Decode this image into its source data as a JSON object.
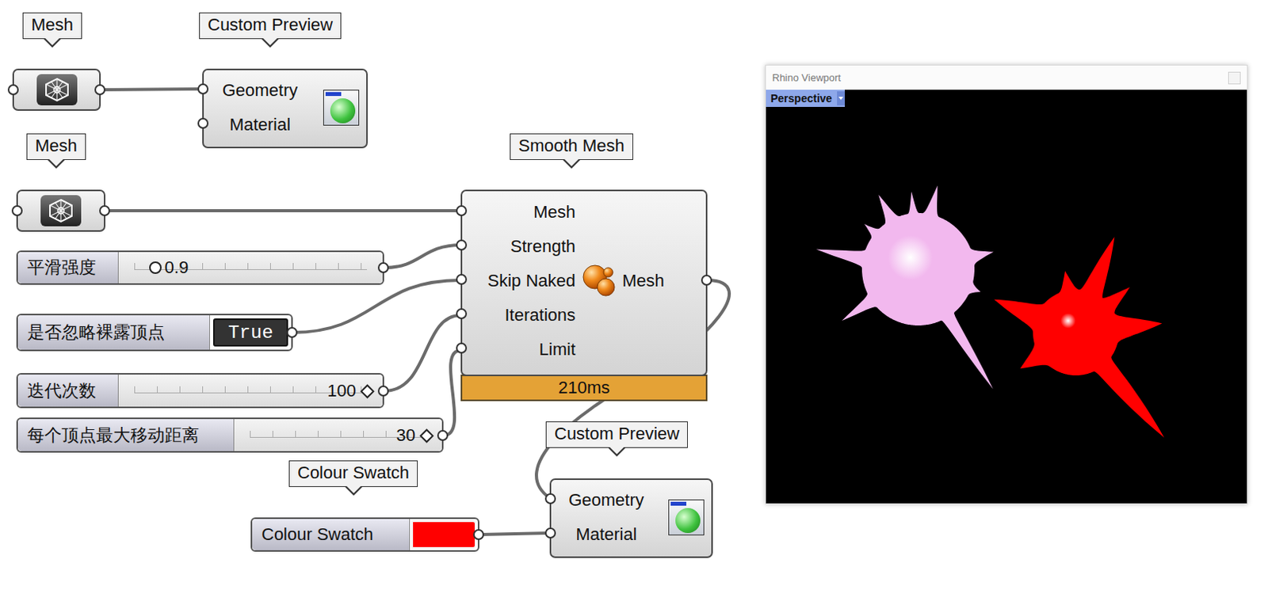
{
  "canvas": {
    "nodes": [
      {
        "kind": "mesh",
        "tag": "Mesh"
      },
      {
        "kind": "preview",
        "tag": "Custom Preview",
        "inputs": [
          "Geometry",
          "Material"
        ]
      },
      {
        "kind": "mesh",
        "tag": "Mesh"
      },
      {
        "kind": "component",
        "tag": "Smooth Mesh",
        "inputs": [
          "Mesh",
          "Strength",
          "Skip Naked",
          "Iterations",
          "Limit"
        ],
        "output": "Mesh",
        "time": "210ms"
      },
      {
        "kind": "slider",
        "label": "平滑强度",
        "value": "0.9",
        "level": 0.09,
        "handle": "circle"
      },
      {
        "kind": "toggle",
        "label": "是否忽略裸露顶点",
        "value": "True",
        "on": true
      },
      {
        "kind": "slider",
        "label": "迭代次数",
        "value": "100",
        "level": 1,
        "handle": "diamond"
      },
      {
        "kind": "slider",
        "label": "每个顶点最大移动距离",
        "value": "30",
        "level": 1,
        "handle": "diamond"
      },
      {
        "kind": "swatch",
        "tag": "Colour Swatch",
        "label": "Colour Swatch",
        "color": "#ff0000"
      },
      {
        "kind": "preview",
        "tag": "Custom Preview",
        "inputs": [
          "Geometry",
          "Material"
        ]
      }
    ]
  },
  "viewport": {
    "title": "Rhino Viewport",
    "view": "Perspective",
    "objects": [
      {
        "color": "#f2b8ee"
      },
      {
        "color": "#ff0000"
      }
    ]
  }
}
